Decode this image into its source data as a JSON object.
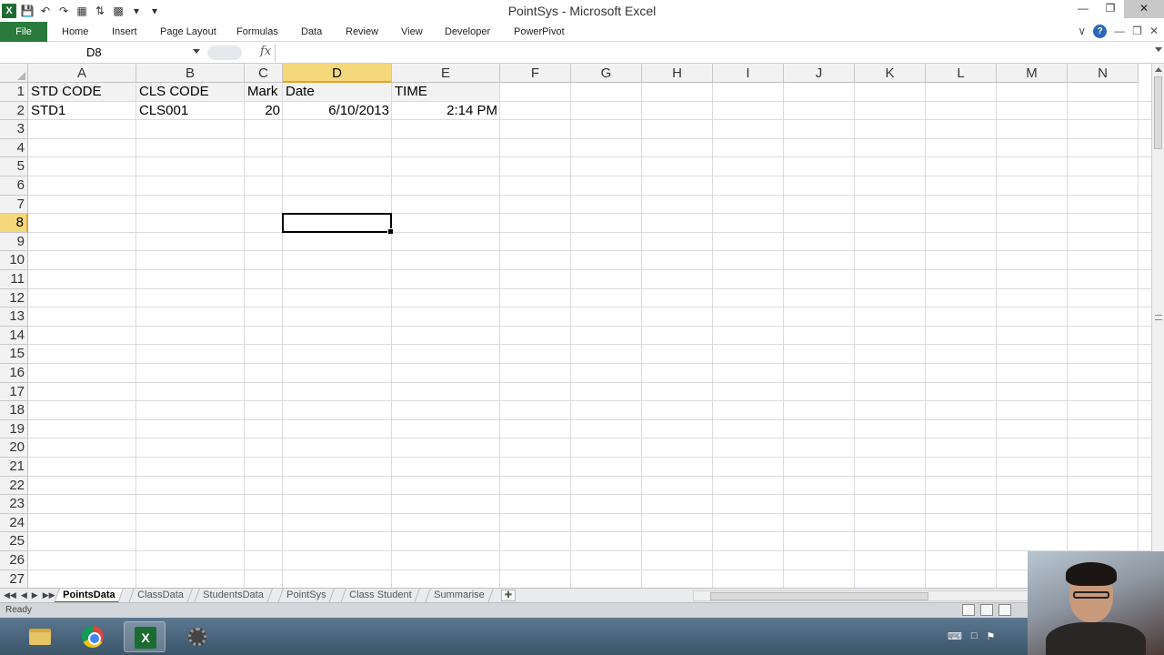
{
  "window": {
    "title": "PointSys  -  Microsoft Excel"
  },
  "ribbon": {
    "file": "File",
    "tabs": [
      "Home",
      "Insert",
      "Page Layout",
      "Formulas",
      "Data",
      "Review",
      "View",
      "Developer",
      "PowerPivot"
    ]
  },
  "formula_bar": {
    "name_box": "D8",
    "fx": "fx",
    "value": ""
  },
  "grid": {
    "columns": [
      "A",
      "B",
      "C",
      "D",
      "E",
      "F",
      "G",
      "H",
      "I",
      "J",
      "K",
      "L",
      "M",
      "N"
    ],
    "selected_column": "D",
    "rows": [
      "1",
      "2",
      "3",
      "4",
      "5",
      "6",
      "7",
      "8",
      "9",
      "10",
      "11",
      "12",
      "13",
      "14",
      "15",
      "16",
      "17",
      "18",
      "19",
      "20",
      "21",
      "22",
      "23",
      "24",
      "25",
      "26",
      "27"
    ],
    "selected_row": "8",
    "selected_cell": "D8",
    "cells": {
      "A1": "STD CODE",
      "B1": "CLS CODE",
      "C1": "Mark",
      "D1": "Date",
      "E1": "TIME",
      "A2": "STD1",
      "B2": "CLS001",
      "C2": "20",
      "D2": "6/10/2013",
      "E2": "2:14 PM"
    }
  },
  "sheets": {
    "tabs": [
      "PointsData",
      "ClassData",
      "StudentsData",
      "PointSys",
      "Class Student",
      "Summarise"
    ],
    "active": "PointsData"
  },
  "status": {
    "mode": "Ready"
  },
  "icons": {
    "app": "excel-icon",
    "qat": [
      "save-icon",
      "undo-icon",
      "redo-icon",
      "customize-icon"
    ],
    "taskbar": [
      "folder-icon",
      "chrome-icon",
      "excel-icon",
      "settings-icon"
    ]
  },
  "colors": {
    "file_tab": "#2a7a3b",
    "selection_header": "#f6d87c",
    "header_bg": "#f2f2f2"
  }
}
